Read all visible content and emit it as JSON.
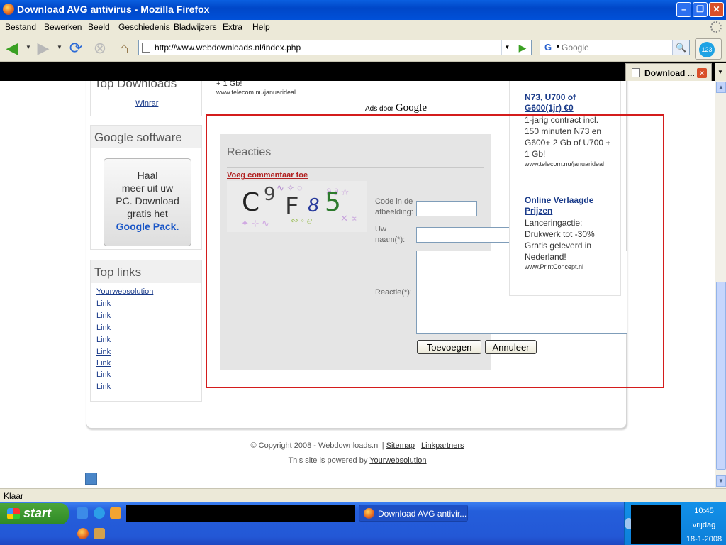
{
  "window": {
    "title": "Download AVG antivirus - Mozilla Firefox"
  },
  "menu": [
    "Bestand",
    "Bewerken",
    "Beeld",
    "Geschiedenis",
    "Bladwijzers",
    "Extra",
    "Help"
  ],
  "nav": {
    "url": "http://www.webdownloads.nl/index.php",
    "search_placeholder": "Google"
  },
  "tab": {
    "label": "Download ..."
  },
  "page": {
    "top_downloads": {
      "title": "Top Downloads",
      "link": "Winrar"
    },
    "google_software": {
      "title": "Google software",
      "pack_lines": [
        "Haal",
        "meer uit uw",
        "PC. Download",
        "gratis het"
      ],
      "pack_link": "Google Pack."
    },
    "top_links": {
      "title": "Top links",
      "items": [
        "Yourwebsolution",
        "Link",
        "Link",
        "Link",
        "Link",
        "Link",
        "Link",
        "Link",
        "Link"
      ]
    },
    "ad_snippet": {
      "line1": "+ 1 Gb!",
      "url": "www.telecom.nu/januarideal"
    },
    "ads_by": {
      "prefix": "Ads door",
      "brand": "Google"
    },
    "reacties": {
      "title": "Reacties",
      "add_comment": "Voeg commentaar toe",
      "captcha_chars": [
        "C",
        "9",
        "F",
        "8",
        "5"
      ],
      "code_label": "Code in de afbeelding:",
      "name_label": "Uw naam(*):",
      "reactie_label": "Reactie(*):",
      "submit": "Toevoegen",
      "cancel": "Annuleer"
    },
    "ads": [
      {
        "title": "N73, U700 of G600(1jr) €0",
        "body": "1-jarig contract incl. 150 minuten N73 en G600+ 2 Gb of U700 + 1 Gb!",
        "url": "www.telecom.nu/januarideal"
      },
      {
        "title": "Online Verlaagde Prijzen",
        "body": "Lanceringactie: Drukwerk tot -30% Gratis geleverd in Nederland!",
        "url": "www.PrintConcept.nl"
      }
    ],
    "footer": {
      "copyright": "© Copyright 2008 - Webdownloads.nl |",
      "sitemap": "Sitemap",
      "sep": "|",
      "linkpartners": "Linkpartners",
      "powered": "This site is powered by",
      "powered_link": "Yourwebsolution"
    }
  },
  "status": {
    "text": "Klaar"
  },
  "taskbar": {
    "start": "start",
    "task": "Download AVG antivir...",
    "time": "10:45",
    "day": "vrijdag",
    "date": "18-1-2008"
  }
}
